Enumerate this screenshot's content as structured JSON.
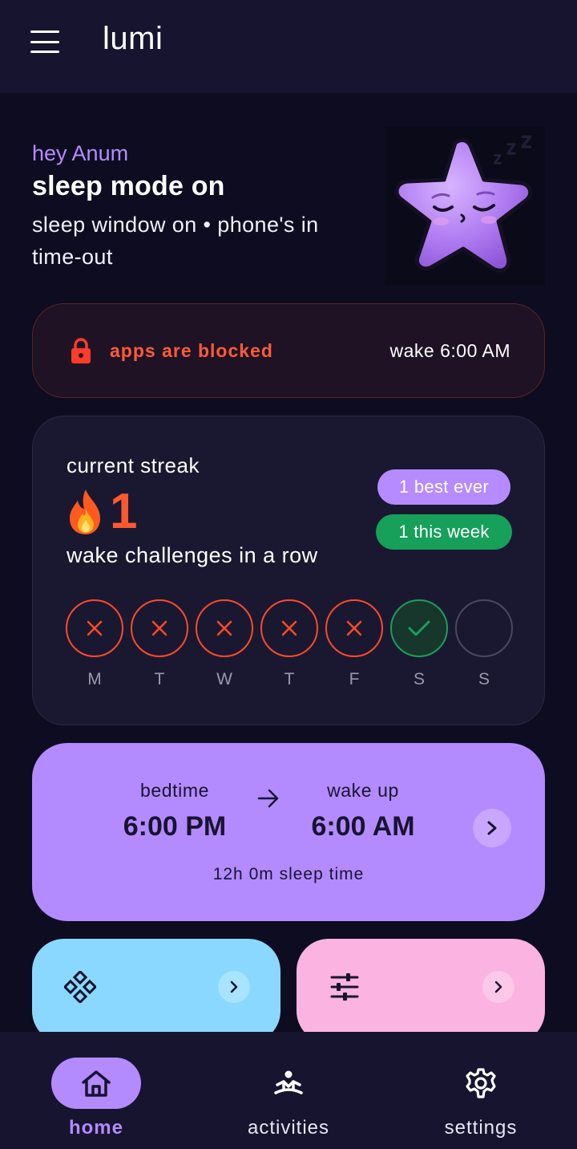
{
  "app": {
    "title": "lumi"
  },
  "greeting": {
    "hey": "hey Anum",
    "title": "sleep mode on",
    "subtitle": "sleep window on • phone's in time-out"
  },
  "blocked": {
    "label": "apps are blocked",
    "wake": "wake 6:00 AM"
  },
  "streak": {
    "label": "current streak",
    "count": "1",
    "description": "wake challenges in a row",
    "best_pill": "1 best ever",
    "week_pill": "1 this week",
    "days": [
      {
        "letter": "M",
        "status": "missed"
      },
      {
        "letter": "T",
        "status": "missed"
      },
      {
        "letter": "W",
        "status": "missed"
      },
      {
        "letter": "T",
        "status": "missed"
      },
      {
        "letter": "F",
        "status": "missed"
      },
      {
        "letter": "S",
        "status": "done"
      },
      {
        "letter": "S",
        "status": "upcoming"
      }
    ]
  },
  "schedule": {
    "bedtime_label": "bedtime",
    "bedtime": "6:00 PM",
    "wake_label": "wake up",
    "wake": "6:00 AM",
    "sleep_time": "12h 0m sleep time"
  },
  "cards": [
    {
      "icon": "gamepad-icon"
    },
    {
      "icon": "sliders-icon"
    }
  ],
  "nav": {
    "home": "home",
    "activities": "activities",
    "settings": "settings"
  },
  "colors": {
    "accent": "#b48aff",
    "danger": "#ff5a3a",
    "success": "#16a05a",
    "background": "#0e0c20"
  }
}
